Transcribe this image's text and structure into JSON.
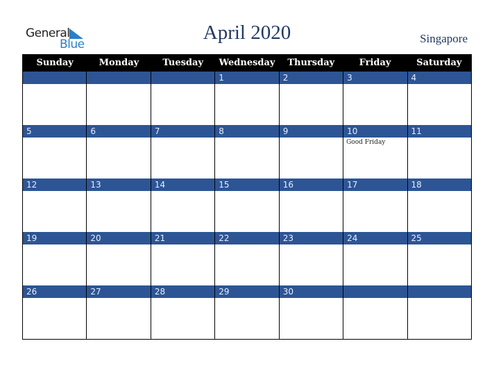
{
  "logo": {
    "general": "General",
    "blue": "Blue"
  },
  "title": "April 2020",
  "country": "Singapore",
  "weekdays": [
    "Sunday",
    "Monday",
    "Tuesday",
    "Wednesday",
    "Thursday",
    "Friday",
    "Saturday"
  ],
  "weeks": [
    [
      {
        "day": "",
        "event": ""
      },
      {
        "day": "",
        "event": ""
      },
      {
        "day": "",
        "event": ""
      },
      {
        "day": "1",
        "event": ""
      },
      {
        "day": "2",
        "event": ""
      },
      {
        "day": "3",
        "event": ""
      },
      {
        "day": "4",
        "event": ""
      }
    ],
    [
      {
        "day": "5",
        "event": ""
      },
      {
        "day": "6",
        "event": ""
      },
      {
        "day": "7",
        "event": ""
      },
      {
        "day": "8",
        "event": ""
      },
      {
        "day": "9",
        "event": ""
      },
      {
        "day": "10",
        "event": "Good Friday"
      },
      {
        "day": "11",
        "event": ""
      }
    ],
    [
      {
        "day": "12",
        "event": ""
      },
      {
        "day": "13",
        "event": ""
      },
      {
        "day": "14",
        "event": ""
      },
      {
        "day": "15",
        "event": ""
      },
      {
        "day": "16",
        "event": ""
      },
      {
        "day": "17",
        "event": ""
      },
      {
        "day": "18",
        "event": ""
      }
    ],
    [
      {
        "day": "19",
        "event": ""
      },
      {
        "day": "20",
        "event": ""
      },
      {
        "day": "21",
        "event": ""
      },
      {
        "day": "22",
        "event": ""
      },
      {
        "day": "23",
        "event": ""
      },
      {
        "day": "24",
        "event": ""
      },
      {
        "day": "25",
        "event": ""
      }
    ],
    [
      {
        "day": "26",
        "event": ""
      },
      {
        "day": "27",
        "event": ""
      },
      {
        "day": "28",
        "event": ""
      },
      {
        "day": "29",
        "event": ""
      },
      {
        "day": "30",
        "event": ""
      },
      {
        "day": "",
        "event": ""
      },
      {
        "day": "",
        "event": ""
      }
    ]
  ],
  "colors": {
    "band": "#2d5595",
    "title": "#233a62",
    "logo_blue": "#2a7fc8"
  }
}
